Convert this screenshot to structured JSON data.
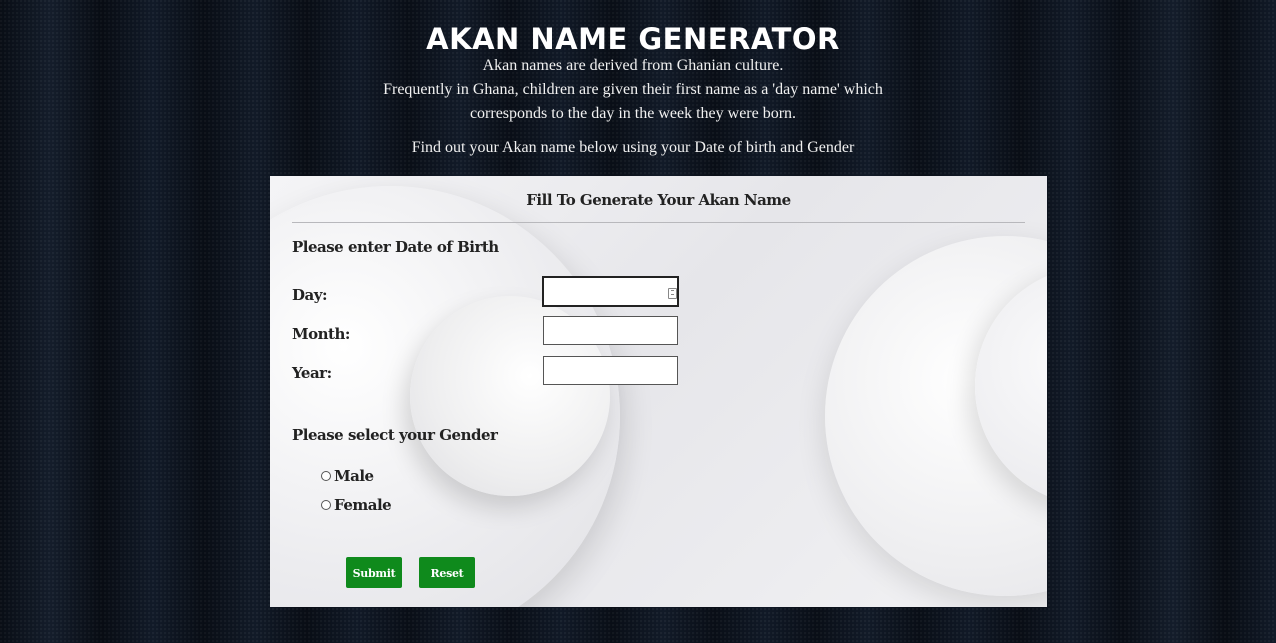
{
  "header": {
    "title": "AKAN NAME GENERATOR"
  },
  "intro": {
    "line1": "Akan names are derived from Ghanian culture.",
    "line2": "Frequently in Ghana, children are given their first name as a 'day name' which",
    "line3": "corresponds to the day in the week they were born.",
    "find_text": "Find out your Akan name below using your Date of birth and Gender"
  },
  "form": {
    "title": "Fill To Generate Your Akan Name",
    "dob_heading": "Please enter Date of Birth",
    "day_label": "Day:",
    "day_value": "",
    "month_label": "Month:",
    "month_value": "",
    "year_label": "Year:",
    "year_value": "",
    "gender_heading": "Please select your Gender",
    "gender_options": [
      {
        "label": "Male",
        "selected": false
      },
      {
        "label": "Female",
        "selected": false
      }
    ],
    "submit_label": "Submit",
    "reset_label": "Reset"
  },
  "colors": {
    "button_bg": "#0f8a1c",
    "page_bg": "#0d1420",
    "card_bg": "#ececef"
  }
}
